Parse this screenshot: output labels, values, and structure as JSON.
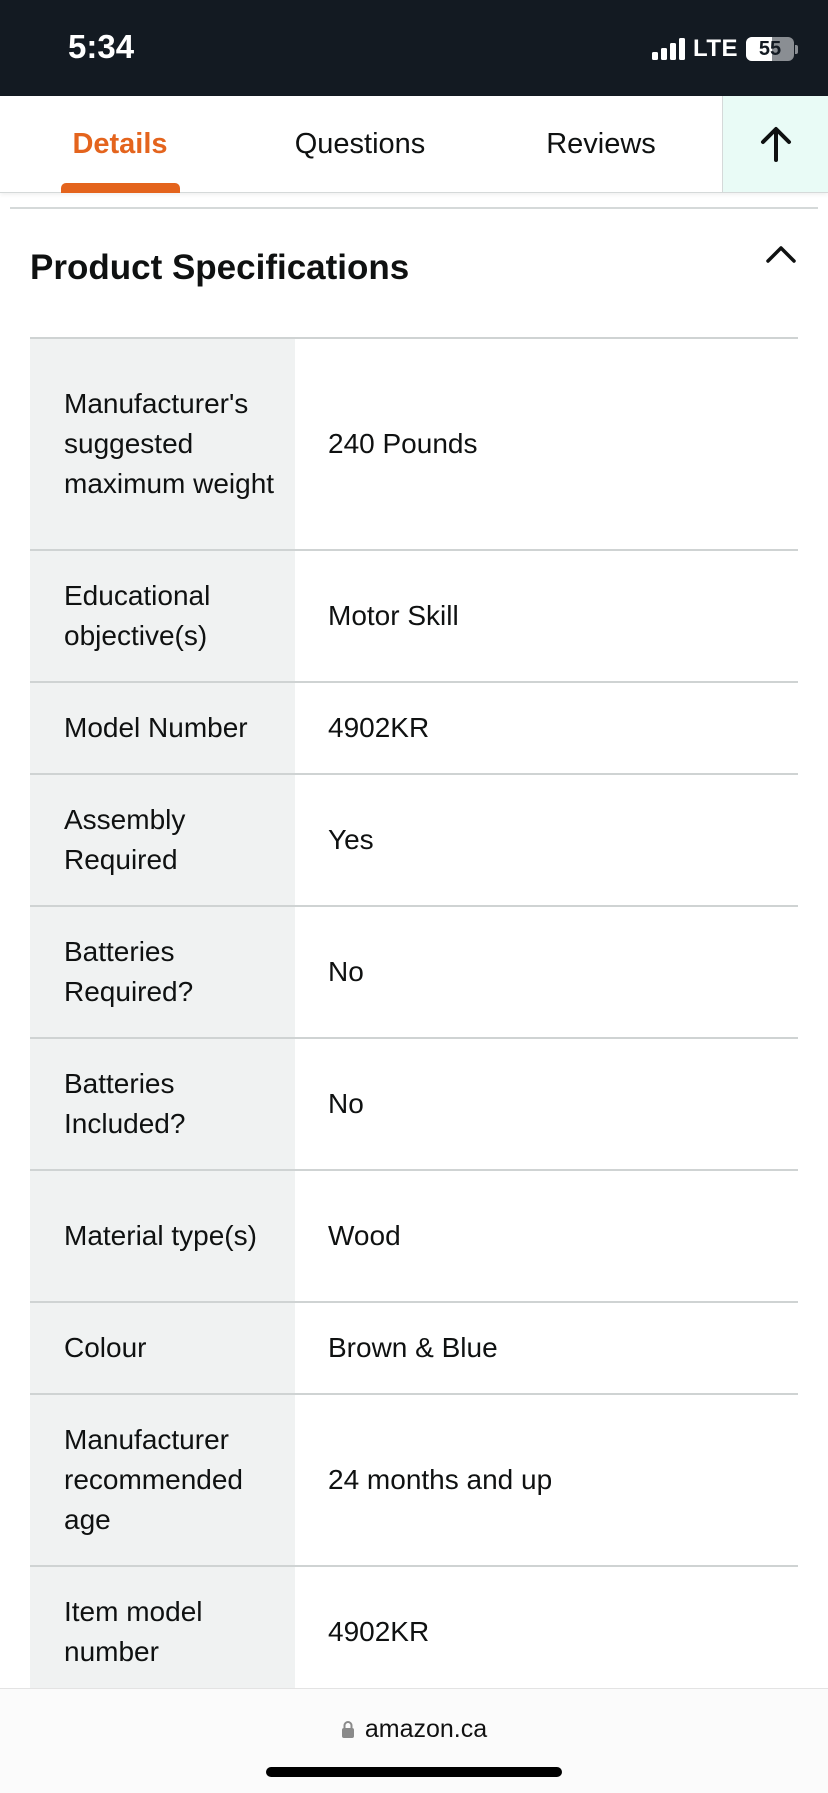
{
  "status_bar": {
    "time": "5:34",
    "network": "LTE",
    "battery_level": "55",
    "battery_fraction": 0.55
  },
  "tabs": [
    {
      "label": "Details",
      "active": true
    },
    {
      "label": "Questions",
      "active": false
    },
    {
      "label": "Reviews",
      "active": false
    }
  ],
  "back_to_top_icon": "arrow-up-icon",
  "section": {
    "title": "Product Specifications",
    "toggle_icon": "chevron-up-icon"
  },
  "specs": [
    {
      "label": "Manufacturer's suggested maximum weight",
      "value": "240 Pounds"
    },
    {
      "label": "Educational objective(s)",
      "value": "Motor Skill"
    },
    {
      "label": "Model Number",
      "value": "4902KR"
    },
    {
      "label": "Assembly Required",
      "value": "Yes"
    },
    {
      "label": "Batteries Required?",
      "value": "No"
    },
    {
      "label": "Batteries Included?",
      "value": "No"
    },
    {
      "label": "Material type(s)",
      "value": "Wood"
    },
    {
      "label": "Colour",
      "value": "Brown & Blue"
    },
    {
      "label": "Manufacturer recommended age",
      "value": "24 months and up"
    },
    {
      "label": "Item model number",
      "value": "4902KR"
    }
  ],
  "url_bar": {
    "domain": "amazon.ca",
    "icon": "lock-icon"
  },
  "colors": {
    "accent": "#e4641d",
    "status_bar_bg": "#131a22",
    "label_cell_bg": "#f0f2f2",
    "up_button_bg": "#e9fbf6"
  }
}
